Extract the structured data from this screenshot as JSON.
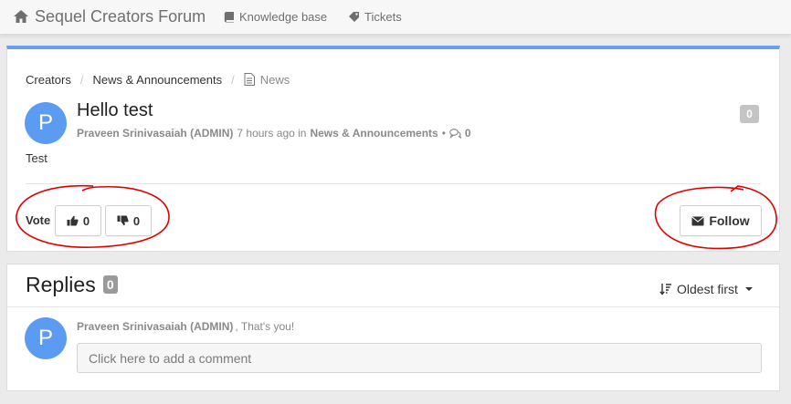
{
  "navbar": {
    "brand": "Sequel Creators Forum",
    "brand_icon": "home-icon",
    "links": [
      {
        "label": "Knowledge base",
        "icon": "book-icon"
      },
      {
        "label": "Tickets",
        "icon": "tag-icon"
      }
    ]
  },
  "breadcrumb": {
    "items": [
      "Creators",
      "News & Announcements"
    ],
    "current": "News",
    "current_icon": "document-icon"
  },
  "post": {
    "avatar_letter": "P",
    "title": "Hello test",
    "author": "Praveen Srinivasaiah (ADMIN)",
    "time": "7 hours ago in",
    "category": "News & Announcements",
    "bullet": "•",
    "comment_count": "0",
    "badge_count": "0",
    "body": "Test"
  },
  "actions": {
    "vote_label": "Vote",
    "upvotes": "0",
    "downvotes": "0",
    "follow_label": "Follow"
  },
  "replies": {
    "title": "Replies",
    "count": "0",
    "sort_label": "Oldest first",
    "reply_avatar_letter": "P",
    "reply_author": "Praveen Srinivasaiah (ADMIN)",
    "reply_note": ", That's you!",
    "comment_placeholder": "Click here to add a comment"
  },
  "colors": {
    "accent_border": "#6d9eeb",
    "avatar": "#5b9cf2",
    "annotation": "#e00000"
  }
}
